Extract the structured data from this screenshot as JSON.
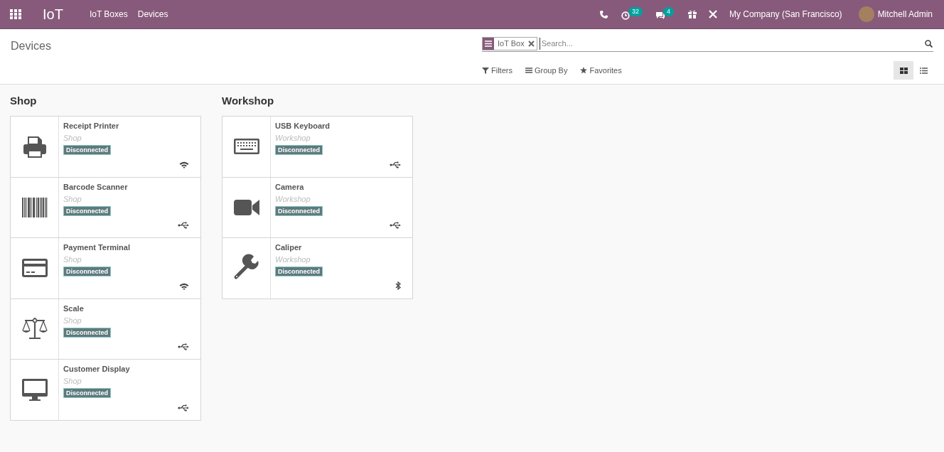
{
  "navbar": {
    "app_name": "IoT",
    "menu": [
      "IoT Boxes",
      "Devices"
    ],
    "activity_count": "32",
    "message_count": "4",
    "company": "My Company (San Francisco)",
    "user": "Mitchell Admin"
  },
  "control_panel": {
    "breadcrumb": "Devices",
    "facet": "IoT Box",
    "search_placeholder": "Search...",
    "filters": [
      {
        "kind": "filter",
        "label": "Filters"
      },
      {
        "kind": "group",
        "label": "Group By"
      },
      {
        "kind": "favorite",
        "label": "Favorites"
      }
    ],
    "views": [
      {
        "kind": "kanban",
        "selected": true
      },
      {
        "kind": "list",
        "selected": false
      }
    ]
  },
  "groups": [
    {
      "title": "Shop",
      "devices": [
        {
          "name": "Receipt Printer",
          "location": "Shop",
          "status": "Disconnected",
          "kind": "printer",
          "connection": {
            "kind": "wifi"
          }
        },
        {
          "name": "Barcode Scanner",
          "location": "Shop",
          "status": "Disconnected",
          "kind": "scanner",
          "connection": {
            "kind": "usb"
          }
        },
        {
          "name": "Payment Terminal",
          "location": "Shop",
          "status": "Disconnected",
          "kind": "payment",
          "connection": {
            "kind": "wifi"
          }
        },
        {
          "name": "Scale",
          "location": "Shop",
          "status": "Disconnected",
          "kind": "scale",
          "connection": {
            "kind": "usb"
          }
        },
        {
          "name": "Customer Display",
          "location": "Shop",
          "status": "Disconnected",
          "kind": "display",
          "connection": {
            "kind": "usb"
          }
        }
      ]
    },
    {
      "title": "Workshop",
      "devices": [
        {
          "name": "USB Keyboard",
          "location": "Workshop",
          "status": "Disconnected",
          "kind": "keyboard",
          "connection": {
            "kind": "usb"
          }
        },
        {
          "name": "Camera",
          "location": "Workshop",
          "status": "Disconnected",
          "kind": "camera",
          "connection": {
            "kind": "usb"
          }
        },
        {
          "name": "Caliper",
          "location": "Workshop",
          "status": "Disconnected",
          "kind": "tool",
          "connection": {
            "kind": "bluetooth"
          }
        }
      ]
    }
  ]
}
